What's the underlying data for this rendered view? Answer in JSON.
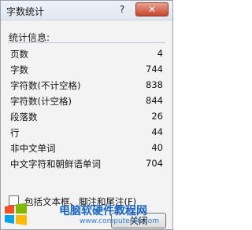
{
  "window": {
    "title": "字数统计",
    "help_label": "?",
    "close_glyph": "✕"
  },
  "statistics": {
    "group_label": "统计信息:",
    "rows": [
      {
        "label": "页数",
        "value": "4"
      },
      {
        "label": "字数",
        "value": "744"
      },
      {
        "label": "字符数(不计空格)",
        "value": "838"
      },
      {
        "label": "字符数(计空格)",
        "value": "844"
      },
      {
        "label": "段落数",
        "value": "26"
      },
      {
        "label": "行",
        "value": "44"
      },
      {
        "label": "非中文单词",
        "value": "40"
      },
      {
        "label": "中文字符和朝鲜语单词",
        "value": "704"
      }
    ]
  },
  "options": {
    "include_textboxes_label": "包括文本框、脚注和尾注(F)",
    "include_textboxes_checked": false
  },
  "buttons": {
    "close_label": "关闭"
  },
  "watermark": {
    "title": "电脑软硬件教程网",
    "url": "www.computer26.com",
    "logo_icon": "windows-logo-icon"
  }
}
